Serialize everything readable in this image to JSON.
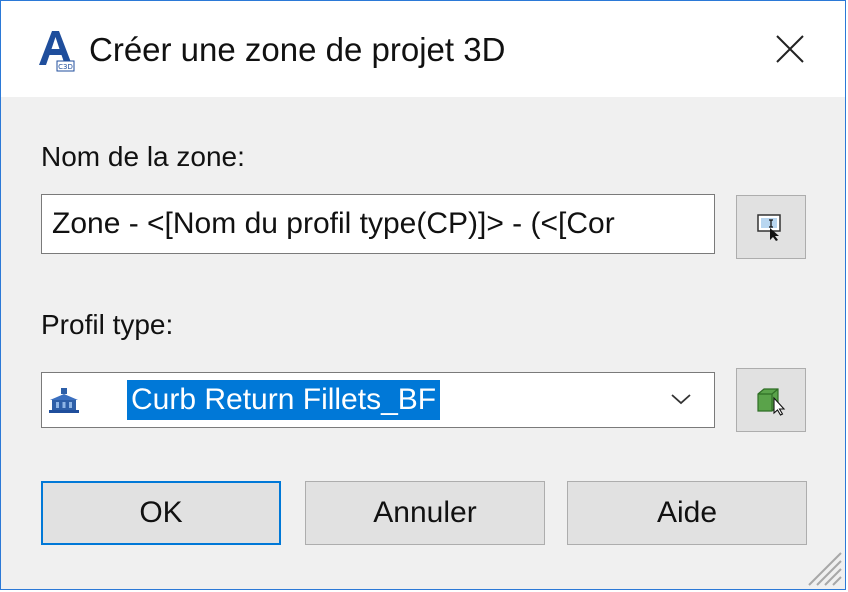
{
  "window": {
    "title": "Créer une zone de projet 3D",
    "icon": "autocad-civil3d-icon",
    "close_icon": "close-icon"
  },
  "zone_name": {
    "label": "Nom de la zone:",
    "value": "Zone - <[Nom du profil type(CP)]> - (<[Cor",
    "picker_icon": "name-template-icon"
  },
  "assembly": {
    "label": "Profil type:",
    "selected": "Curb Return Fillets_BF",
    "item_icon": "assembly-icon",
    "dropdown_icon": "chevron-down-icon",
    "pick_icon": "pick-assembly-icon"
  },
  "buttons": {
    "ok": "OK",
    "cancel": "Annuler",
    "help": "Aide"
  },
  "colors": {
    "accent": "#0078d7",
    "window_border": "#2b79d7",
    "dialog_bg": "#f0f0f0",
    "button_bg": "#e1e1e1"
  }
}
